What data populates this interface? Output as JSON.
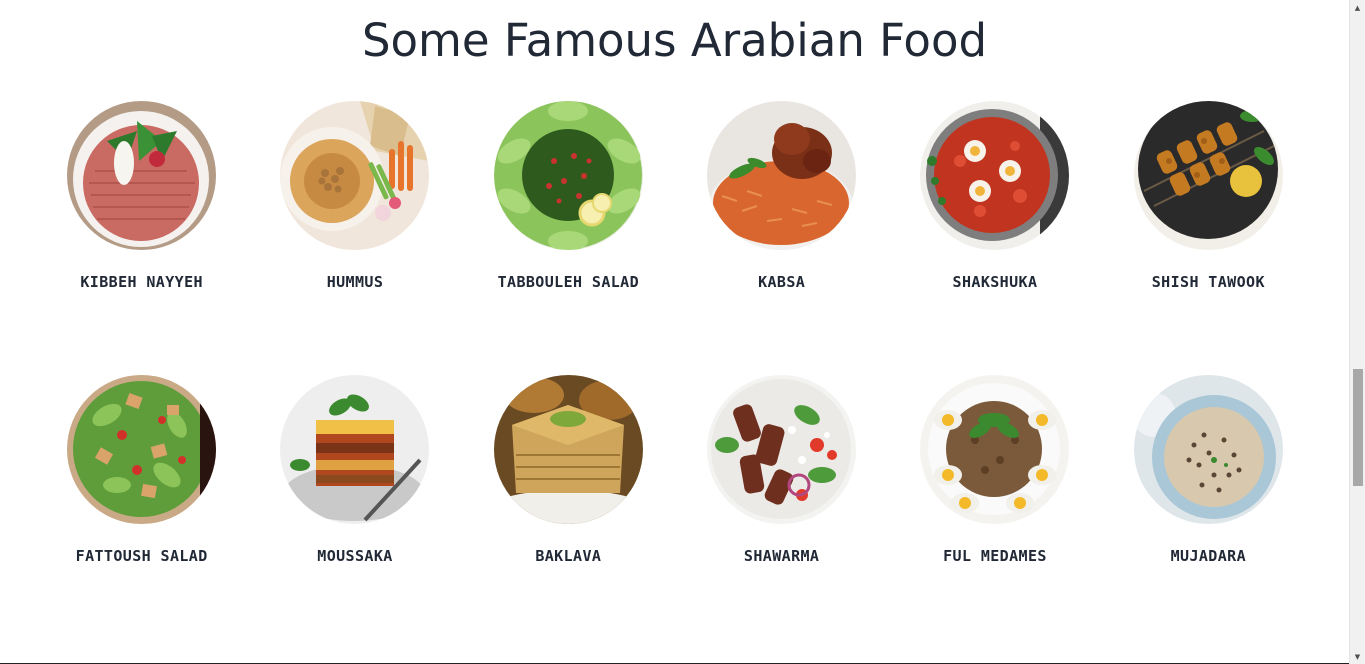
{
  "page": {
    "title": "Some Famous Arabian Food"
  },
  "foods": [
    {
      "name": "KIBBEH NAYYEH",
      "icon": "kibbeh-nayyeh-photo"
    },
    {
      "name": "HUMMUS",
      "icon": "hummus-photo"
    },
    {
      "name": "TABBOULEH SALAD",
      "icon": "tabbouleh-salad-photo"
    },
    {
      "name": "KABSA",
      "icon": "kabsa-photo"
    },
    {
      "name": "SHAKSHUKA",
      "icon": "shakshuka-photo"
    },
    {
      "name": "SHISH TAWOOK",
      "icon": "shish-tawook-photo"
    },
    {
      "name": "FATTOUSH SALAD",
      "icon": "fattoush-salad-photo"
    },
    {
      "name": "MOUSSAKA",
      "icon": "moussaka-photo"
    },
    {
      "name": "BAKLAVA",
      "icon": "baklava-photo"
    },
    {
      "name": "SHAWARMA",
      "icon": "shawarma-photo"
    },
    {
      "name": "FUL MEDAMES",
      "icon": "ful-medames-photo"
    },
    {
      "name": "MUJADARA",
      "icon": "mujadara-photo"
    }
  ],
  "scrollbar": {
    "up_arrow": "▲",
    "down_arrow": "▼"
  },
  "colors": {
    "text": "#212936",
    "background": "#ffffff"
  }
}
